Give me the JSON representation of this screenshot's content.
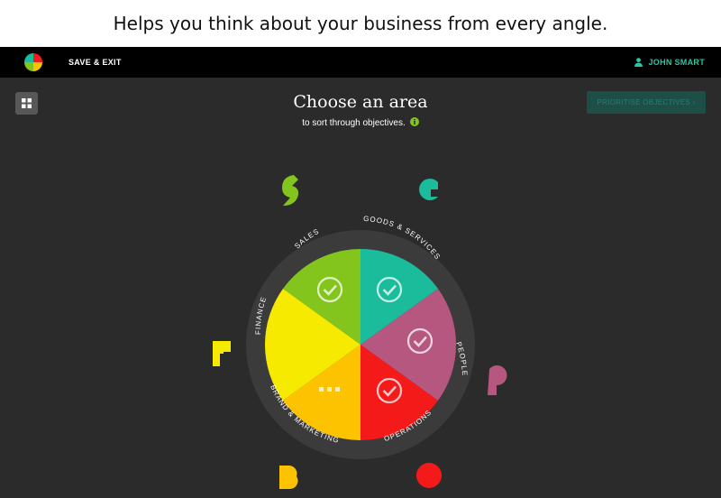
{
  "caption": "Helps you think about your business from every angle.",
  "topbar": {
    "save_exit": "SAVE & EXIT",
    "user_name": "JOHN SMART"
  },
  "header": {
    "title": "Choose an area",
    "subtitle": "to sort through objectives.",
    "prioritise_button": "PRIORITISE OBJECTIVES ›"
  },
  "colors": {
    "sales": "#83c51d",
    "goods_services": "#1abc9c",
    "people": "#b5577f",
    "operations": "#f51a1a",
    "brand_marketing": "#fdc300",
    "finance": "#f6ea00",
    "ring": "#3b3b3b",
    "accent": "#2fc3a4"
  },
  "wheel": {
    "labels": {
      "sales": "SALES",
      "goods_services": "GOODS & SERVICES",
      "people": "PEOPLE",
      "operations": "OPERATIONS",
      "brand_marketing": "BRAND & MARKETING",
      "finance": "FINANCE"
    },
    "status": {
      "sales": "check-icon",
      "goods_services": "check-icon",
      "people": "check-icon",
      "operations": "check-icon",
      "brand_marketing": "in-progress-dots-icon",
      "finance": "none"
    }
  }
}
